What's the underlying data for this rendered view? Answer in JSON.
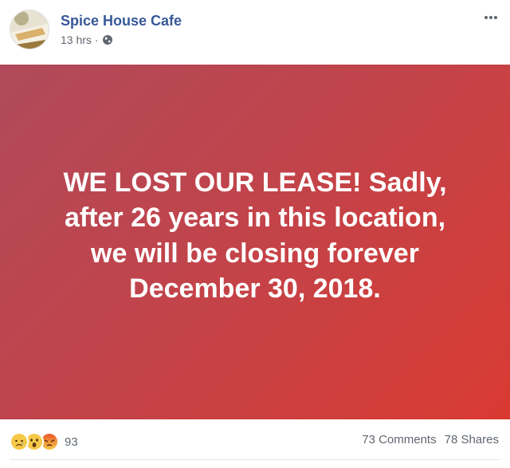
{
  "post": {
    "page_name": "Spice House Cafe",
    "time": "13 hrs",
    "separator": "·",
    "privacy_icon": "globe-icon",
    "more_icon": "more-options-icon"
  },
  "banner": {
    "lines": [
      "WE LOST OUR LEASE! Sadly,",
      "after 26 years in this location,",
      "we will be closing forever",
      "December 30, 2018."
    ],
    "gradient_colors": [
      "#b04a5a",
      "#d93a32"
    ]
  },
  "footer": {
    "reaction_icons": [
      "sad-reaction-icon",
      "wow-reaction-icon",
      "angry-reaction-icon"
    ],
    "reaction_count": "93",
    "comments": "73 Comments",
    "shares": "78 Shares"
  },
  "colors": {
    "page_name": "#385898",
    "meta_text": "#616770"
  }
}
